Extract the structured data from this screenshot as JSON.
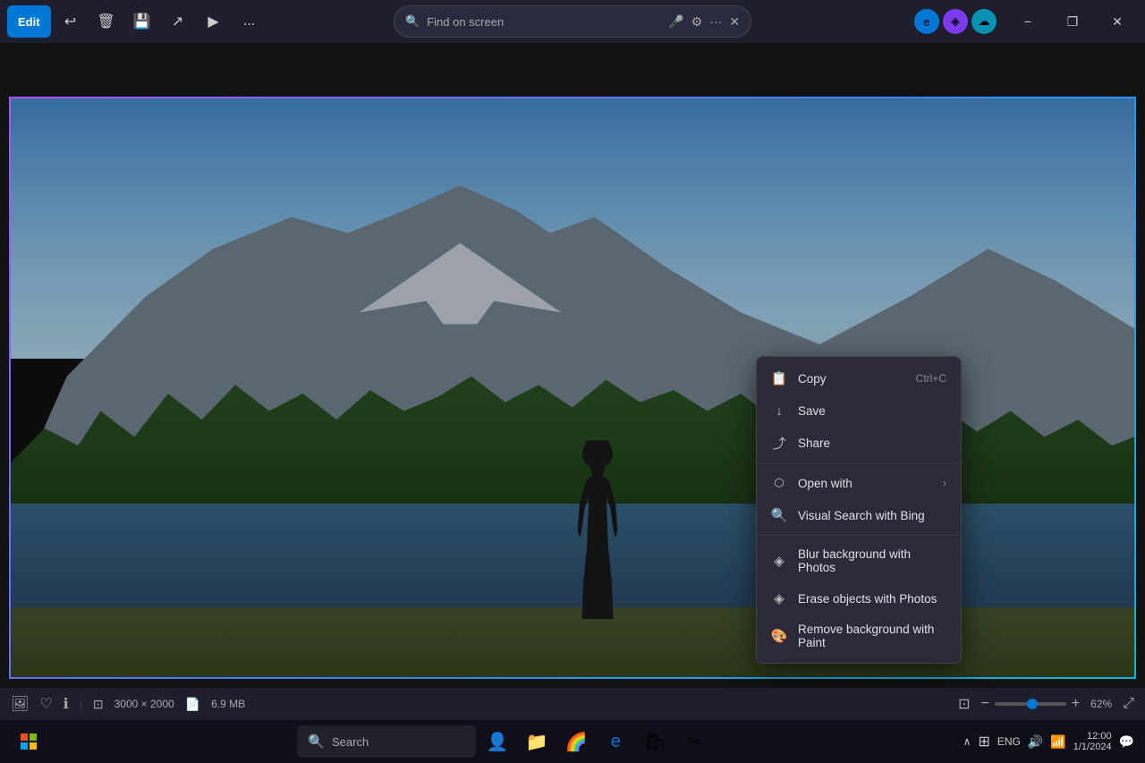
{
  "titlebar": {
    "edit_label": "Edit",
    "search_placeholder": "Find on screen",
    "more_label": "...",
    "minimize": "−",
    "maximize": "❐",
    "close": "✕"
  },
  "context_menu": {
    "items": [
      {
        "id": "copy",
        "label": "Copy",
        "shortcut": "Ctrl+C",
        "icon": "📋",
        "has_arrow": false
      },
      {
        "id": "save",
        "label": "Save",
        "shortcut": "",
        "icon": "💾",
        "has_arrow": false
      },
      {
        "id": "share",
        "label": "Share",
        "shortcut": "",
        "icon": "↗",
        "has_arrow": false
      },
      {
        "id": "open-with",
        "label": "Open with",
        "shortcut": "",
        "icon": "⬡",
        "has_arrow": true
      },
      {
        "id": "visual-search",
        "label": "Visual Search with Bing",
        "shortcut": "",
        "icon": "🔍",
        "has_arrow": false
      },
      {
        "id": "blur-bg",
        "label": "Blur background with Photos",
        "shortcut": "",
        "icon": "◈",
        "has_arrow": false
      },
      {
        "id": "erase-objects",
        "label": "Erase objects with Photos",
        "shortcut": "",
        "icon": "◈",
        "has_arrow": false
      },
      {
        "id": "remove-bg",
        "label": "Remove background with Paint",
        "shortcut": "",
        "icon": "🎨",
        "has_arrow": false
      }
    ]
  },
  "statusbar": {
    "dimensions": "3000 × 2000",
    "filesize": "6.9 MB",
    "zoom": "62%"
  },
  "taskbar": {
    "search_placeholder": "Search",
    "icons": [
      {
        "id": "windows",
        "symbol": "⊞"
      },
      {
        "id": "edge",
        "symbol": "e"
      },
      {
        "id": "explorer",
        "symbol": "📁"
      },
      {
        "id": "photos",
        "symbol": "🖼"
      },
      {
        "id": "microsoft-store",
        "symbol": "🛒"
      },
      {
        "id": "snipping",
        "symbol": "✂"
      }
    ]
  }
}
